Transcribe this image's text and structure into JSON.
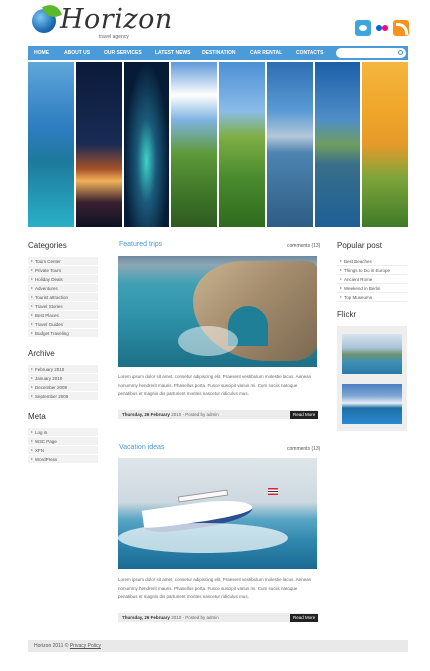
{
  "brand": {
    "title": "Horizon",
    "tagline": "travel agency"
  },
  "social": {
    "icons": [
      "twitter-icon",
      "flickr-icon",
      "rss-icon"
    ]
  },
  "nav": {
    "items": [
      "HOME",
      "ABOUT US",
      "OUR SERVICES",
      "LATEST NEWS",
      "DESTINATION",
      "CAR RENTAL",
      "CONTACTS"
    ]
  },
  "search": {
    "value": ""
  },
  "categories": {
    "title": "Categories",
    "items": [
      "Tours Center",
      "Private Tours",
      "Holiday Deals",
      "Adventures",
      "Tourist attraction",
      "Travel Stories",
      "Best Places",
      "Travel Guides",
      "Budget Traveling"
    ]
  },
  "archive": {
    "title": "Archive",
    "items": [
      "February 2010",
      "January 2010",
      "December 2009",
      "September 2009"
    ]
  },
  "meta_box": {
    "title": "Meta",
    "items": [
      "Log in",
      "W3C Page",
      "XFN",
      "WordPress"
    ]
  },
  "posts": [
    {
      "title": "Featured trips",
      "comments": "comments (13)",
      "excerpt": "Lorem ipsum dolor sit amet, consetur adipiscing elit. Praesent vestibulum molestie lacus. Aenean nonummy hendrerit mauris. Phasellus porta. Fusce suscipit varius mi. Cum sociis natoque penatibus et magnis dis parturient montes nascetur ridiculus mus.",
      "date": "Thursday, 26 February",
      "byline": "2010 - Posted by admin",
      "read_more": "Read More"
    },
    {
      "title": "Vacation ideas",
      "comments": "comments (13)",
      "excerpt": "Lorem ipsum dolor sit amet, consetur adipiscing elit. Praesent vestibulum molestie lacus. Aenean nonummy hendrerit mauris. Phasellus porta. Fusce suscipit varius mi. Cum sociis natoque penatibus et magnis dis parturient montes nascetur ridiculus mus.",
      "date": "Thursday, 26 February",
      "byline": "2010 - Posted by admin",
      "read_more": "Read More"
    }
  ],
  "popular": {
    "title": "Popular post",
    "items": [
      "Best Beaches",
      "Things to Do in Europe",
      "Ancient Rome",
      "Weekend in Berlin",
      "Top Museums"
    ]
  },
  "flickr": {
    "title": "Flickr"
  },
  "footer": {
    "text": "Horizon 2011 ©",
    "link": "Privacy Policy"
  },
  "colors": {
    "accent": "#4a9bd7",
    "nav": "#4a9bd7",
    "dark": "#222222"
  }
}
